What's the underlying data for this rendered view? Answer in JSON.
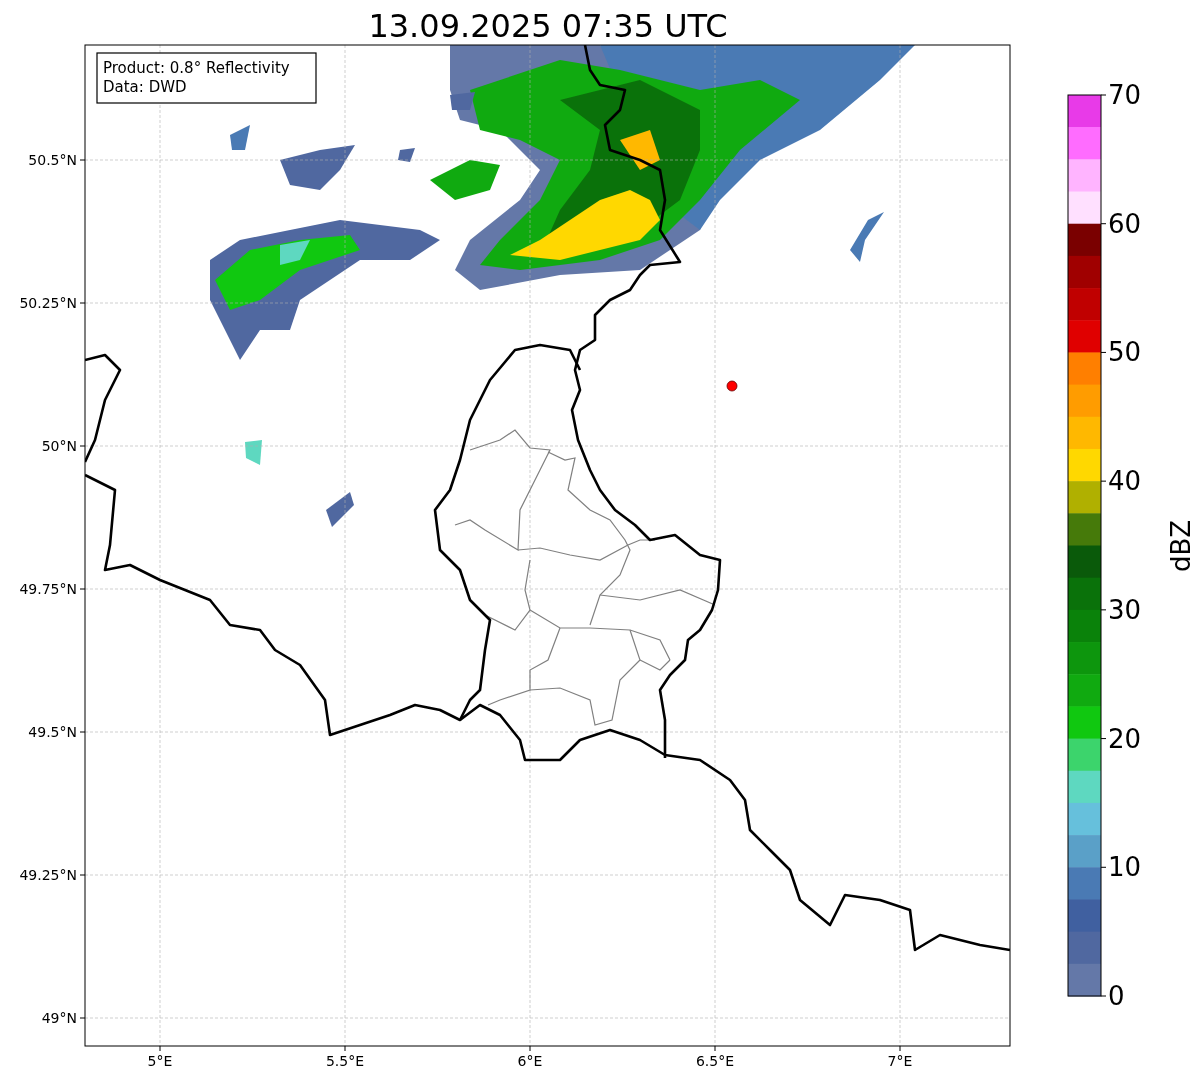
{
  "title": "13.09.2025 07:35 UTC",
  "info_box": [
    "Product: 0.8° Reflectivity",
    "Data: DWD"
  ],
  "map": {
    "lon_ticks": [
      "5°E",
      "5.5°E",
      "6°E",
      "6.5°E",
      "7°E"
    ],
    "lat_ticks": [
      "50.5°N",
      "50.25°N",
      "50°N",
      "49.75°N",
      "49.5°N",
      "49.25°N",
      "49°N"
    ]
  },
  "colorbar": {
    "label": "dBZ",
    "ticks": [
      "70",
      "60",
      "50",
      "40",
      "30",
      "20",
      "10",
      "0"
    ],
    "segments": [
      {
        "color": "#e83ae8"
      },
      {
        "color": "#ff6cff"
      },
      {
        "color": "#ffb4ff"
      },
      {
        "color": "#ffe0ff"
      },
      {
        "color": "#7a0000"
      },
      {
        "color": "#a00000"
      },
      {
        "color": "#c00000"
      },
      {
        "color": "#e00000"
      },
      {
        "color": "#ff7f00"
      },
      {
        "color": "#ff9c00"
      },
      {
        "color": "#ffb800"
      },
      {
        "color": "#ffd800"
      },
      {
        "color": "#b0b000"
      },
      {
        "color": "#467a0a"
      },
      {
        "color": "#0a5a0a"
      },
      {
        "color": "#0a720a"
      },
      {
        "color": "#0a820a"
      },
      {
        "color": "#0d960d"
      },
      {
        "color": "#10aa10"
      },
      {
        "color": "#10c810"
      },
      {
        "color": "#3cd46c"
      },
      {
        "color": "#5ed8c0"
      },
      {
        "color": "#66c0dc"
      },
      {
        "color": "#5aa0c8"
      },
      {
        "color": "#4a7ab4"
      },
      {
        "color": "#4060a0"
      },
      {
        "color": "#5068a0"
      },
      {
        "color": "#6478a8"
      }
    ]
  }
}
